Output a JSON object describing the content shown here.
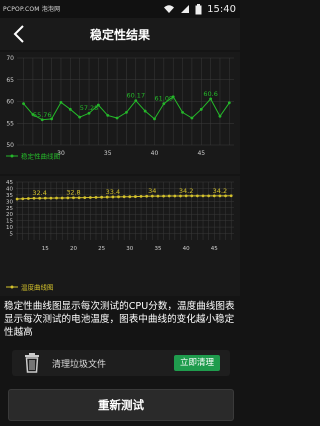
{
  "status_bar": {
    "watermark": "PCPOP.COM 泡泡网",
    "time": "15:40",
    "battery_icon": "battery-full-icon",
    "wifi_icon": "wifi-icon",
    "signal_icon": "signal-icon"
  },
  "header": {
    "title": "稳定性结果",
    "back_icon": "chevron-left-icon"
  },
  "charts": {
    "colors": {
      "cpu": "#25b82a",
      "temp": "#d4c22c",
      "grid": "#3a3a3a",
      "label": "#cfcfcf"
    }
  },
  "chart_data": [
    {
      "type": "line",
      "legend": "稳定性曲线图",
      "ylim": [
        50,
        70
      ],
      "yticks": [
        50,
        55,
        60,
        65,
        70
      ],
      "xticks": [
        30,
        35,
        40,
        45
      ],
      "x": [
        26,
        27,
        28,
        29,
        30,
        31,
        32,
        33,
        34,
        35,
        36,
        37,
        38,
        39,
        40,
        41,
        42,
        43,
        44,
        45,
        46,
        47,
        48
      ],
      "values": [
        59.5,
        57.0,
        55.8,
        56.0,
        59.8,
        58.2,
        56.4,
        57.3,
        59.2,
        56.8,
        56.2,
        57.5,
        60.2,
        57.8,
        56.0,
        59.5,
        61.1,
        57.5,
        56.2,
        58.2,
        60.6,
        56.6,
        59.7
      ],
      "labels": [
        {
          "x": 28,
          "text": "55.76"
        },
        {
          "x": 33,
          "text": "57.28"
        },
        {
          "x": 38,
          "text": "60.17"
        },
        {
          "x": 41,
          "text": "61.09"
        },
        {
          "x": 46,
          "text": "60.6"
        }
      ]
    },
    {
      "type": "line",
      "legend": "温度曲线图",
      "ylim": [
        0,
        45
      ],
      "yticks": [
        5,
        10,
        15,
        20,
        25,
        30,
        35,
        40,
        45
      ],
      "xticks": [
        15,
        20,
        25,
        30,
        35,
        40,
        45
      ],
      "x": [
        10,
        11,
        12,
        13,
        14,
        15,
        16,
        17,
        18,
        19,
        20,
        21,
        22,
        23,
        24,
        25,
        26,
        27,
        28,
        29,
        30,
        31,
        32,
        33,
        34,
        35,
        36,
        37,
        38,
        39,
        40,
        41,
        42,
        43,
        44,
        45,
        46,
        47,
        48
      ],
      "values": [
        31.8,
        32.0,
        32.2,
        32.4,
        32.4,
        32.5,
        32.5,
        32.6,
        32.6,
        32.7,
        32.8,
        32.8,
        32.9,
        33.0,
        33.1,
        33.2,
        33.3,
        33.4,
        33.5,
        33.6,
        33.6,
        33.7,
        33.8,
        33.9,
        34.0,
        34.0,
        34.0,
        34.1,
        34.1,
        34.1,
        34.2,
        34.2,
        34.2,
        34.2,
        34.2,
        34.2,
        34.2,
        34.2,
        34.3
      ],
      "labels": [
        {
          "x": 14,
          "text": "32.4"
        },
        {
          "x": 20,
          "text": "32.8"
        },
        {
          "x": 27,
          "text": "33.4"
        },
        {
          "x": 34,
          "text": "34"
        },
        {
          "x": 40,
          "text": "34.2"
        },
        {
          "x": 46,
          "text": "34.2"
        }
      ]
    }
  ],
  "description": "稳定性曲线图显示每次测试的CPU分数，温度曲线图表显示每次测试的电池温度，图表中曲线的变化越小稳定性越高",
  "clean": {
    "icon": "trash-icon",
    "label": "清理垃圾文件",
    "button": "立即清理"
  },
  "retest_button": "重新测试"
}
